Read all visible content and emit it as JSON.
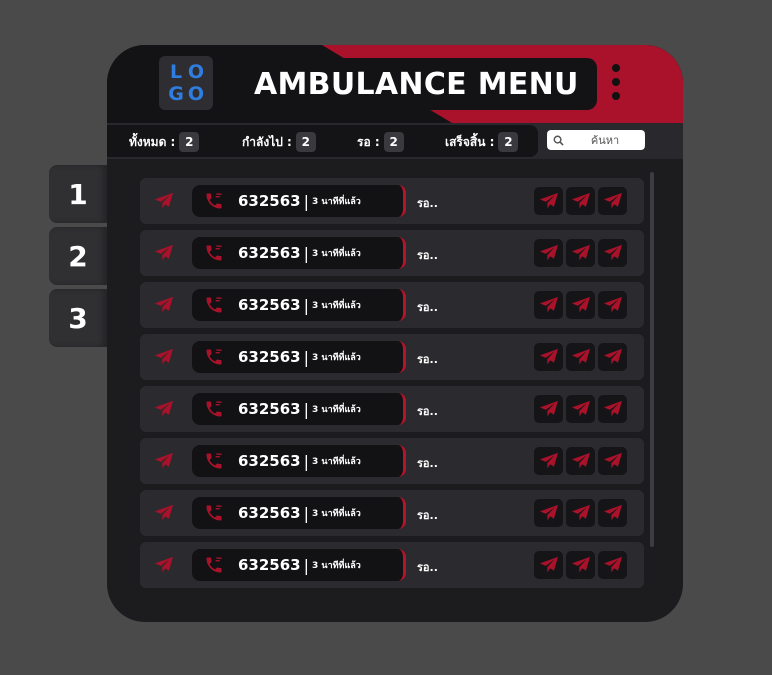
{
  "side_tabs": [
    "1",
    "2",
    "3"
  ],
  "header": {
    "logo_letters": [
      "L",
      "O",
      "G",
      "O"
    ],
    "title": "AMBULANCE MENU"
  },
  "status": {
    "all_label": "ทั้งหมด :",
    "all_count": "2",
    "going_label": "กำลังไป :",
    "going_count": "2",
    "waiting_label": "รอ :",
    "waiting_count": "2",
    "done_label": "เสร็จสิ้น :",
    "done_count": "2"
  },
  "search": {
    "placeholder": "ค้นหา"
  },
  "rows": [
    {
      "number": "632563",
      "separator": "|",
      "ago": "3 นาทีที่แล้ว",
      "status": "รอ.."
    },
    {
      "number": "632563",
      "separator": "|",
      "ago": "3 นาทีที่แล้ว",
      "status": "รอ.."
    },
    {
      "number": "632563",
      "separator": "|",
      "ago": "3 นาทีที่แล้ว",
      "status": "รอ.."
    },
    {
      "number": "632563",
      "separator": "|",
      "ago": "3 นาทีที่แล้ว",
      "status": "รอ.."
    },
    {
      "number": "632563",
      "separator": "|",
      "ago": "3 นาทีที่แล้ว",
      "status": "รอ.."
    },
    {
      "number": "632563",
      "separator": "|",
      "ago": "3 นาทีที่แล้ว",
      "status": "รอ.."
    },
    {
      "number": "632563",
      "separator": "|",
      "ago": "3 นาทีที่แล้ว",
      "status": "รอ.."
    },
    {
      "number": "632563",
      "separator": "|",
      "ago": "3 นาทีที่แล้ว",
      "status": "รอ.."
    }
  ],
  "icons": {
    "row_indicator": "paper-plane-icon",
    "call": "phone-icon",
    "actions": [
      "paper-plane-icon",
      "paper-plane-icon",
      "paper-plane-icon"
    ],
    "search": "magnifier-icon",
    "menu": "kebab-menu-icon"
  },
  "colors": {
    "accent": "#b5142a",
    "background": "#4a4a4a",
    "panel": "#1c1b1e",
    "logo": "#2f7de0"
  }
}
